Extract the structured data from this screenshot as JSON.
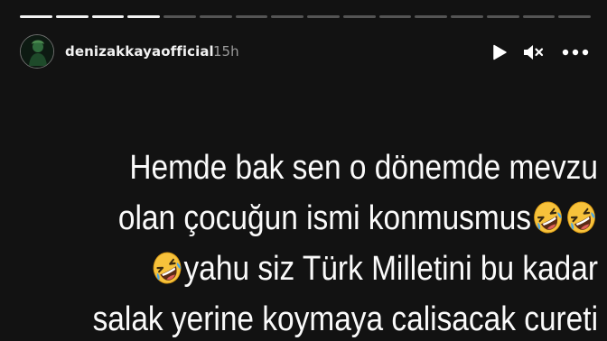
{
  "story": {
    "progress_segments": [
      {
        "state": "done"
      },
      {
        "state": "done"
      },
      {
        "state": "done"
      },
      {
        "state": "done"
      },
      {
        "state": "pending"
      },
      {
        "state": "pending"
      },
      {
        "state": "pending"
      },
      {
        "state": "pending"
      },
      {
        "state": "pending"
      },
      {
        "state": "pending"
      },
      {
        "state": "pending"
      },
      {
        "state": "pending"
      },
      {
        "state": "pending"
      },
      {
        "state": "pending"
      },
      {
        "state": "pending"
      },
      {
        "state": "pending"
      }
    ],
    "header": {
      "username": "denizakkayaofficial",
      "time_ago": "15h",
      "avatar_icon": "profile-avatar-icon",
      "play_icon": "play-icon",
      "mute_icon": "speaker-muted-icon",
      "more_icon": "more-options-icon"
    },
    "message": {
      "line1": "Hemde bak sen o dönemde mevzu",
      "line2": "olan çocuğun ismi konmusmus",
      "line3": "yahu siz Türk Milletini bu kadar",
      "line4": "salak yerine koymaya calisacak cureti",
      "emoji_icon": "rolling-on-the-floor-laughing-icon"
    },
    "colors": {
      "background": "#121212",
      "text": "#fafafa",
      "muted_text": "#9a9a9a",
      "emoji_face": "#f7c23b"
    }
  }
}
